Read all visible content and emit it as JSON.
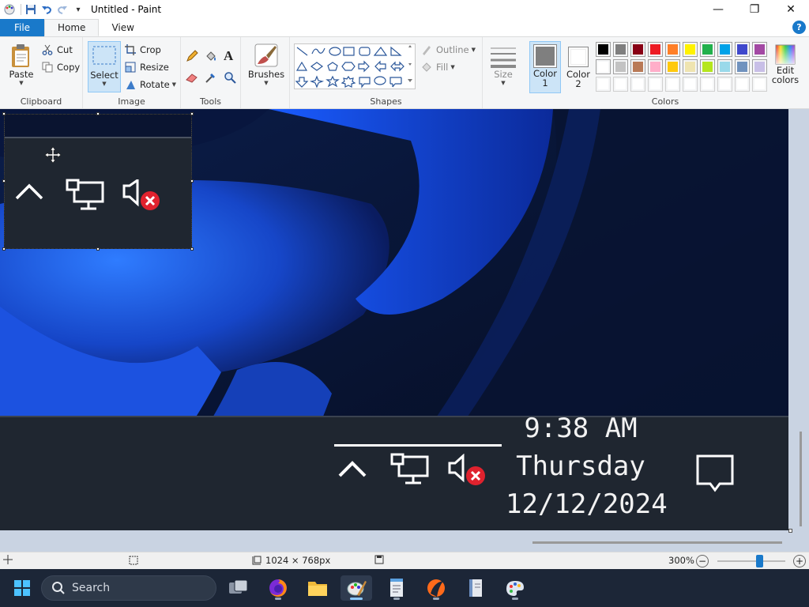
{
  "window": {
    "title": "Untitled - Paint",
    "controls": {
      "minimize": "—",
      "maximize": "❐",
      "close": "✕"
    }
  },
  "tabs": [
    {
      "label": "File"
    },
    {
      "label": "Home"
    },
    {
      "label": "View"
    }
  ],
  "ribbon": {
    "clipboard": {
      "paste": "Paste",
      "cut": "Cut",
      "copy": "Copy",
      "group": "Clipboard"
    },
    "image": {
      "select": "Select",
      "crop": "Crop",
      "resize": "Resize",
      "rotate": "Rotate",
      "group": "Image"
    },
    "tools": {
      "group": "Tools",
      "text_tool": "A"
    },
    "brushes": {
      "label": "Brushes"
    },
    "shapes": {
      "outline": "Outline",
      "fill": "Fill",
      "group": "Shapes"
    },
    "size": {
      "label": "Size"
    },
    "color1": {
      "label": "Color",
      "num": "1",
      "value": "#7f7f7f"
    },
    "color2": {
      "label": "Color",
      "num": "2",
      "value": "#ffffff"
    },
    "colors": {
      "group": "Colors",
      "row1": [
        "#000000",
        "#7f7f7f",
        "#880015",
        "#ed1c24",
        "#ff7f27",
        "#fff200",
        "#22b14c",
        "#00a2e8",
        "#3f48cc",
        "#a349a4"
      ],
      "row2": [
        "#ffffff",
        "#c3c3c3",
        "#b97a57",
        "#ffaec9",
        "#ffc90e",
        "#efe4b0",
        "#b5e61d",
        "#99d9ea",
        "#7092be",
        "#c8bfe7"
      ],
      "row3": [
        "#ffffff",
        "#ffffff",
        "#ffffff",
        "#ffffff",
        "#ffffff",
        "#ffffff",
        "#ffffff",
        "#ffffff",
        "#ffffff",
        "#ffffff"
      ]
    },
    "edit_colors": {
      "line1": "Edit",
      "line2": "colors"
    }
  },
  "canvas_content": {
    "time": "9:38 AM",
    "day": "Thursday",
    "date": "12/12/2024"
  },
  "statusbar": {
    "dimensions": "1024 × 768px",
    "zoom": "300%",
    "zoom_level": 0.62
  },
  "taskbar": {
    "search_placeholder": "Search"
  }
}
